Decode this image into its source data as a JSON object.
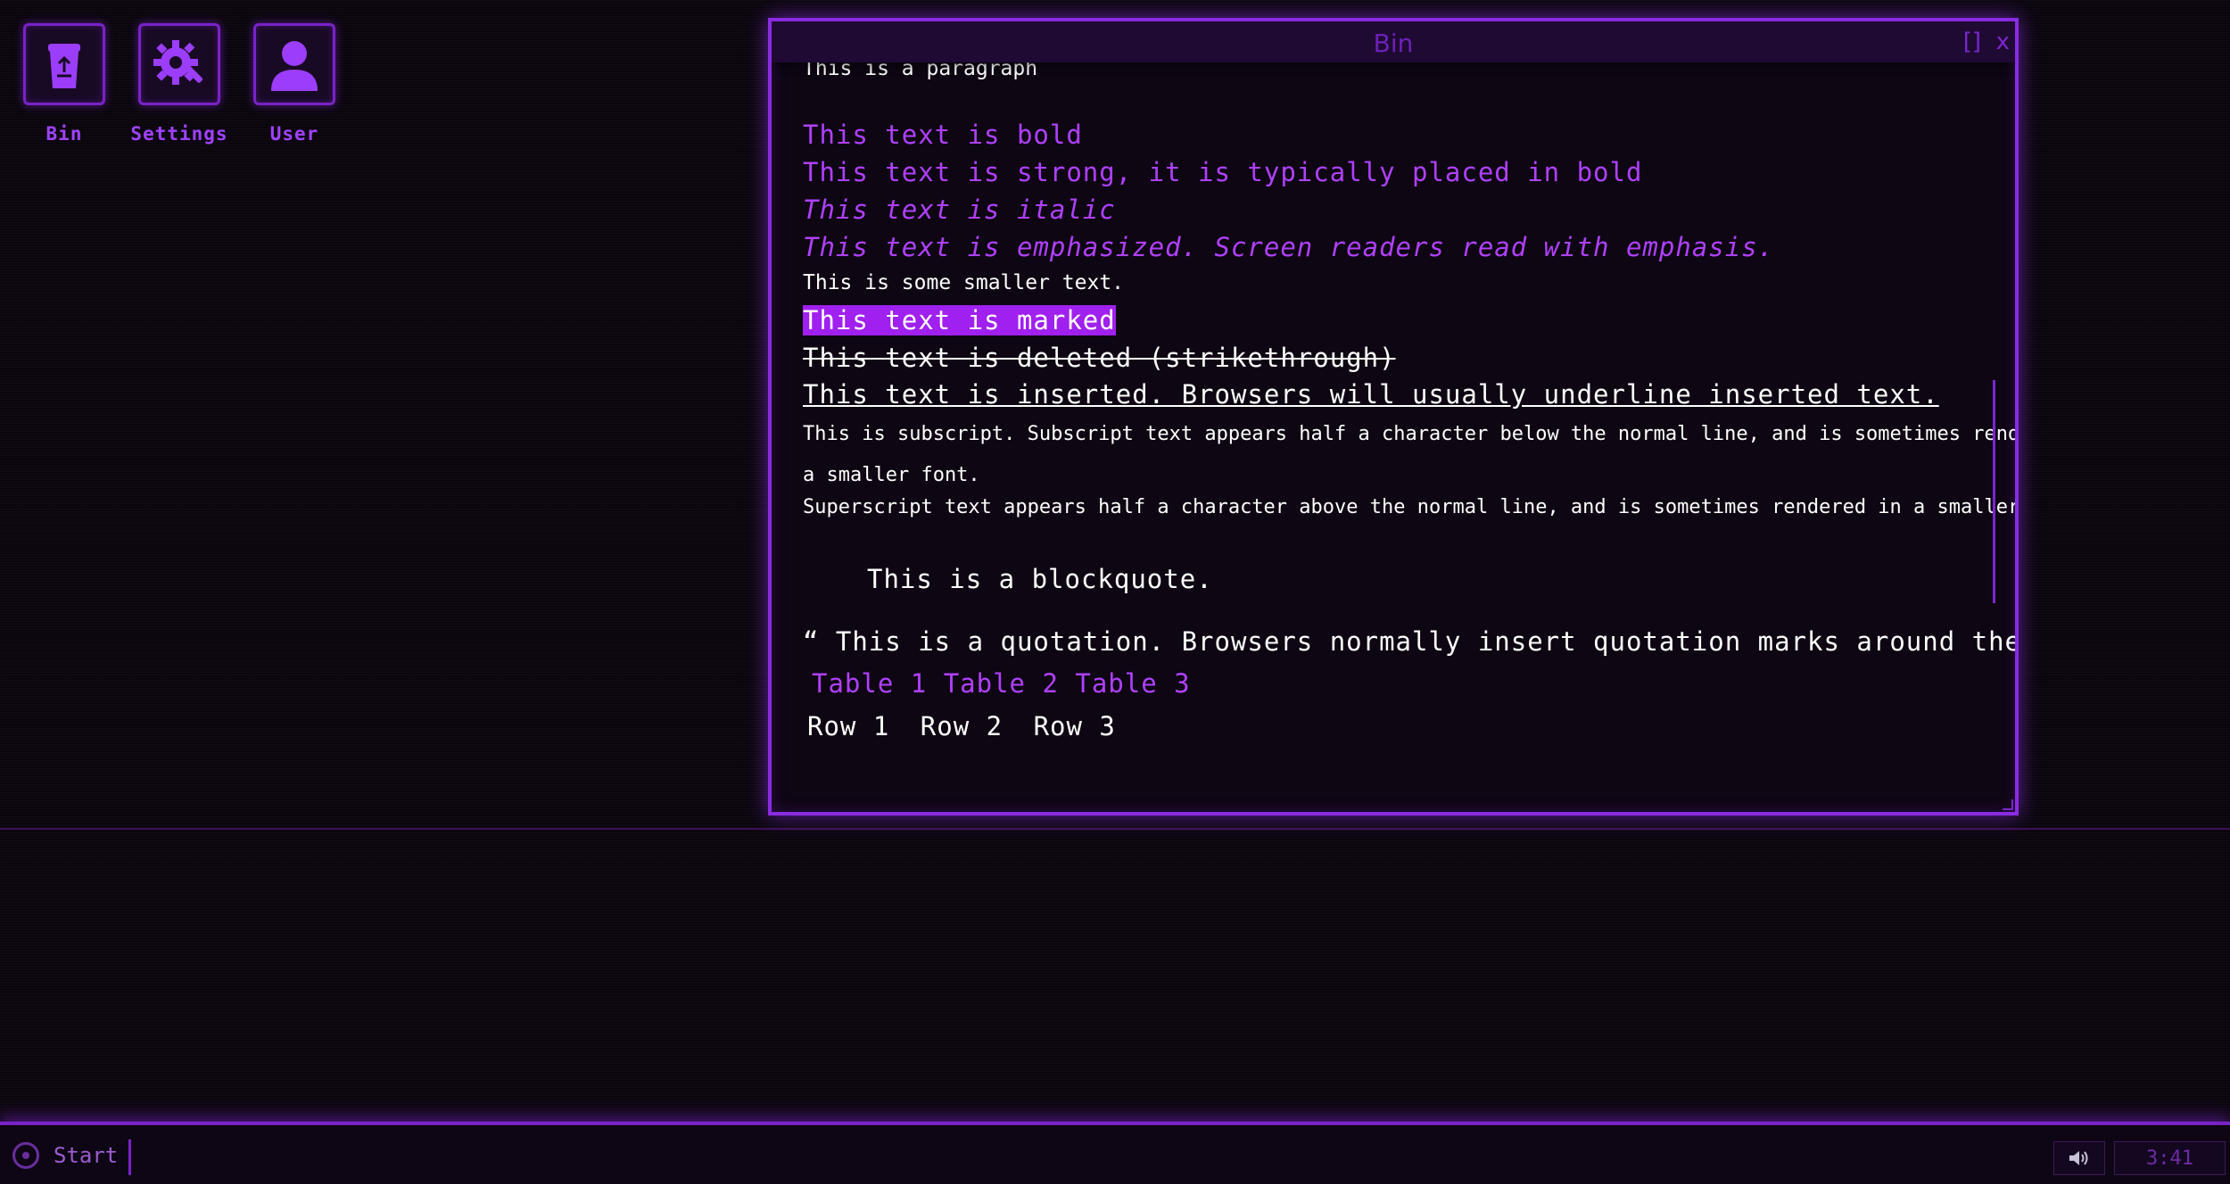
{
  "desktop": {
    "icons": [
      {
        "label": "Bin",
        "icon": "recycle-bin-icon"
      },
      {
        "label": "Settings",
        "icon": "settings-gear-icon"
      },
      {
        "label": "User",
        "icon": "user-icon"
      }
    ]
  },
  "window": {
    "title": "Bin",
    "maximize": "[]",
    "close": "x",
    "content": {
      "paragraph": "This is a paragraph",
      "bold": "This text is bold",
      "strong": "This text is strong, it is typically placed in bold",
      "italic": "This text is italic",
      "emphasized": "This text is emphasized. Screen readers read with emphasis.",
      "small": "This is some smaller text.",
      "marked": "This text is marked",
      "deleted": "This text is deleted (strikethrough)",
      "inserted": "This text is inserted. Browsers will usually underline inserted text.",
      "subscript_line1": "This is subscript. Subscript text appears half a character below the normal line, and is sometimes rendered in",
      "subscript_line2": "a smaller font.",
      "superscript": "Superscript text appears half a character above the normal line, and is sometimes rendered in a smaller font.",
      "blockquote": "This is a blockquote.",
      "quotation": "“ This is a quotation. Browsers normally insert quotation marks around the quotation.”",
      "table": {
        "headers": [
          "Table 1",
          "Table 2",
          "Table 3"
        ],
        "rows": [
          [
            "Row 1",
            "Row 2",
            "Row 3"
          ]
        ]
      }
    }
  },
  "taskbar": {
    "start_label": "Start",
    "volume_icon": "speaker-icon",
    "clock": "3:41"
  },
  "colors": {
    "accent": "#8a2be2",
    "text_purple": "#b040ff",
    "mark": "#a020f0",
    "background": "#0b060e"
  }
}
